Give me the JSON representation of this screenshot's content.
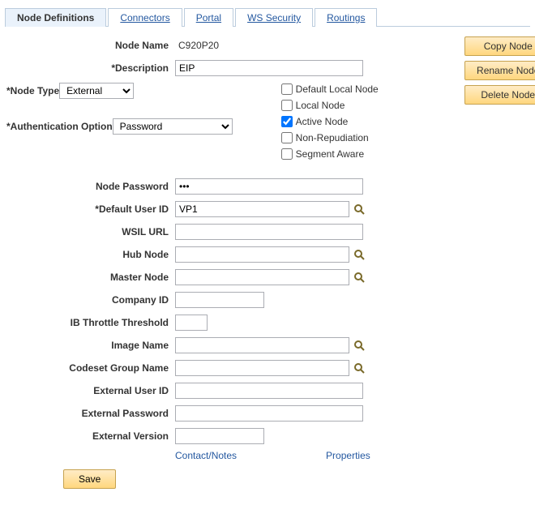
{
  "tabs": {
    "node_definitions": "Node Definitions",
    "connectors": "Connectors",
    "portal": "Portal",
    "ws_security": "WS Security",
    "routings": "Routings"
  },
  "labels": {
    "node_name": "Node Name",
    "description": "*Description",
    "node_type": "*Node Type",
    "auth_option": "*Authentication Option",
    "node_password": "Node Password",
    "default_user_id": "*Default User ID",
    "wsil_url": "WSIL URL",
    "hub_node": "Hub Node",
    "master_node": "Master Node",
    "company_id": "Company ID",
    "ib_throttle": "IB Throttle Threshold",
    "image_name": "Image Name",
    "codeset_group": "Codeset Group Name",
    "ext_user_id": "External User ID",
    "ext_password": "External Password",
    "ext_version": "External Version"
  },
  "values": {
    "node_name": "C920P20",
    "description": "EIP",
    "node_type": "External",
    "auth_option": "Password",
    "node_password": "•••",
    "default_user_id": "VP1",
    "wsil_url": "",
    "hub_node": "",
    "master_node": "",
    "company_id": "",
    "ib_throttle": "",
    "image_name": "",
    "codeset_group": "",
    "ext_user_id": "",
    "ext_password": "",
    "ext_version": ""
  },
  "checks": {
    "default_local_node": "Default Local Node",
    "local_node": "Local Node",
    "active_node": "Active Node",
    "non_repudiation": "Non-Repudiation",
    "segment_aware": "Segment Aware"
  },
  "buttons": {
    "copy": "Copy Node",
    "rename": "Rename Node",
    "delete": "Delete Node",
    "save": "Save"
  },
  "links": {
    "contact_notes": "Contact/Notes",
    "properties": "Properties"
  }
}
